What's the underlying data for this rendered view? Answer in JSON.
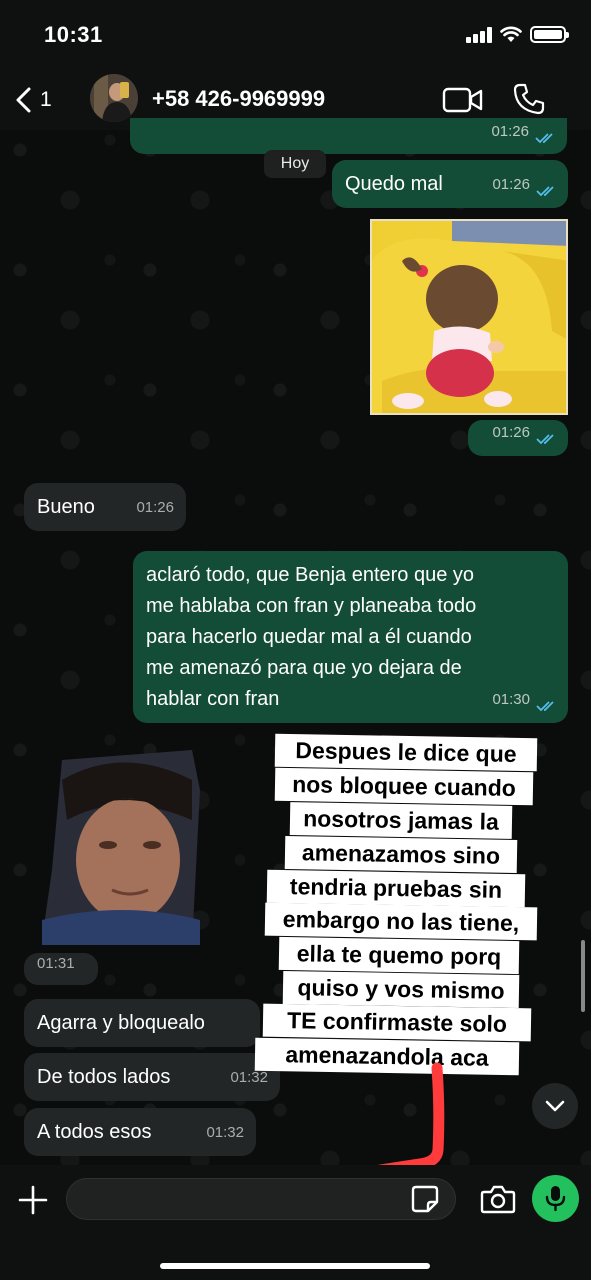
{
  "status_bar": {
    "time": "10:31"
  },
  "header": {
    "back_count": "1",
    "contact_name": "+58 426-9969999"
  },
  "date_chip": "Hoy",
  "messages": [
    {
      "id": "m0",
      "direction": "outgoing",
      "text": "",
      "time": "01:26",
      "status": "read"
    },
    {
      "id": "m1",
      "direction": "outgoing",
      "text": "Quedo mal",
      "time": "01:26",
      "status": "read"
    },
    {
      "id": "m2",
      "direction": "outgoing",
      "type": "sticker",
      "time": "01:26",
      "status": "read"
    },
    {
      "id": "m3",
      "direction": "incoming",
      "text": "Bueno",
      "time": "01:26"
    },
    {
      "id": "m4",
      "direction": "outgoing",
      "lines": [
        "aclaró todo, que Benja entero que yo",
        "me hablaba con fran y planeaba todo",
        "para hacerlo quedar mal a él cuando",
        "me amenazó para que yo dejara de",
        "hablar con fran"
      ],
      "time": "01:30",
      "status": "read"
    },
    {
      "id": "m5",
      "direction": "incoming",
      "type": "photo",
      "time": "01:31"
    },
    {
      "id": "m6",
      "direction": "incoming",
      "text": "Agarra y bloquealo",
      "time": ""
    },
    {
      "id": "m7",
      "direction": "incoming",
      "text": "De todos lados",
      "time": "01:32"
    },
    {
      "id": "m8",
      "direction": "incoming",
      "text": "A todos esos",
      "time": "01:32"
    }
  ],
  "overlay_caption": {
    "lines": [
      "Despues le dice que",
      "nos bloquee cuando",
      "nosotros jamas la",
      "amenazamos sino",
      "tendria pruebas sin",
      "embargo no las tiene,",
      "ella te quemo porq",
      "quiso y vos mismo",
      "TE confirmaste solo",
      "amenazandola  aca"
    ]
  },
  "input_bar": {
    "placeholder": "",
    "value": ""
  },
  "colors": {
    "outgoing_bubble": "#144d37",
    "incoming_bubble": "#232626",
    "read_ticks": "#53bdeb",
    "mic_button": "#22c15e",
    "red_annotation": "#ff3b3b"
  },
  "icons": [
    "back-chevron-icon",
    "video-call-icon",
    "phone-icon",
    "read-receipt-icon",
    "chevron-down-icon",
    "plus-icon",
    "sticker-icon",
    "camera-icon",
    "microphone-icon"
  ]
}
